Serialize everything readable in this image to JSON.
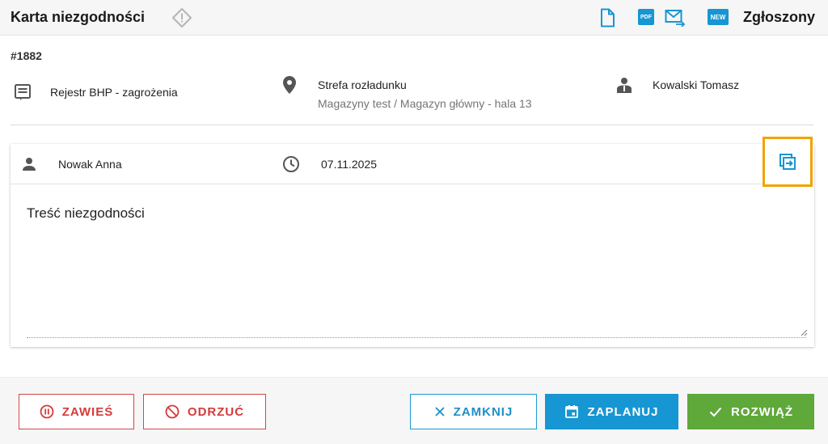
{
  "header": {
    "title": "Karta niezgodności",
    "status": "Zgłoszony",
    "pdf_label": "PDF",
    "new_label": "NEW",
    "colors": {
      "accent": "#1696d2"
    }
  },
  "issue": {
    "number": "#1882",
    "registry": "Rejestr BHP - zagrożenia",
    "location_title": "Strefa rozładunku",
    "location_path": "Magazyny test / Magazyn główny - hala 13",
    "responsible": "Kowalski Tomasz"
  },
  "card": {
    "reporter": "Nowak Anna",
    "date": "07.11.2025",
    "content": "Treść niezgodności",
    "highlight_color": "#f0a300"
  },
  "footer": {
    "suspend": "ZAWIEŚ",
    "reject": "ODRZUĆ",
    "close": "ZAMKNIJ",
    "schedule": "ZAPLANUJ",
    "resolve": "ROZWIĄŻ",
    "colors": {
      "danger": "#d63a3a",
      "primary": "#1696d2",
      "success": "#5fa83a"
    }
  }
}
